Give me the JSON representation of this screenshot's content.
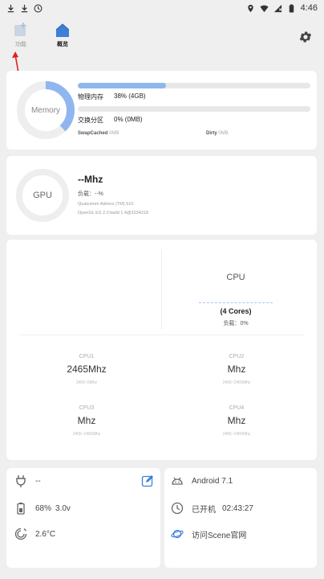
{
  "status_bar": {
    "time": "4:46",
    "icons": [
      "download-icon",
      "download-icon",
      "clock-icon",
      "location-icon",
      "wifi-icon",
      "no-sim-icon",
      "battery-icon"
    ]
  },
  "app_bar": {
    "tabs": [
      {
        "label": "功能",
        "icon": "add-box-icon"
      },
      {
        "label": "概览",
        "icon": "home-icon"
      }
    ],
    "settings_icon": "gear-icon"
  },
  "memory": {
    "label": "Memory",
    "used_fraction": 0.38,
    "physical_label": "物理内存",
    "physical_value": "38% (4GB)",
    "swap_label": "交换分区",
    "swap_value": "0% (0MB)",
    "swap_fraction": 0,
    "swapcached_label": "SwapCached",
    "swapcached_value": "0MB",
    "dirty_label": "Dirty",
    "dirty_value": "0MB",
    "accent": "#8fb6ee"
  },
  "gpu": {
    "label": "GPU",
    "freq": "--Mhz",
    "load_label": "负载：",
    "load_value": "--%",
    "renderer": "Qualcomm Adreno (TM) 510",
    "version": "OpenGL ES 2.0 build 1.4@3234318"
  },
  "cpu": {
    "label": "CPU",
    "cores": "(4 Cores)",
    "load_label": "负载：",
    "load_value": "0%",
    "core_list": [
      {
        "name": "CPU1",
        "freq": "2465Mhz",
        "range": "2465~0Mhz"
      },
      {
        "name": "CPU2",
        "freq": "Mhz",
        "range": "2465~2465Mhz"
      },
      {
        "name": "CPU3",
        "freq": "Mhz",
        "range": "2465~2465Mhz"
      },
      {
        "name": "CPU4",
        "freq": "Mhz",
        "range": "2465~2465Mhz"
      }
    ]
  },
  "device": {
    "charge": "--",
    "battery": "68%",
    "voltage": "3.0v",
    "temperature": "2.6°C"
  },
  "system": {
    "android": "Android 7.1",
    "uptime_label": "已开机",
    "uptime_value": "02:43:27",
    "website": "访问Scene官网"
  }
}
